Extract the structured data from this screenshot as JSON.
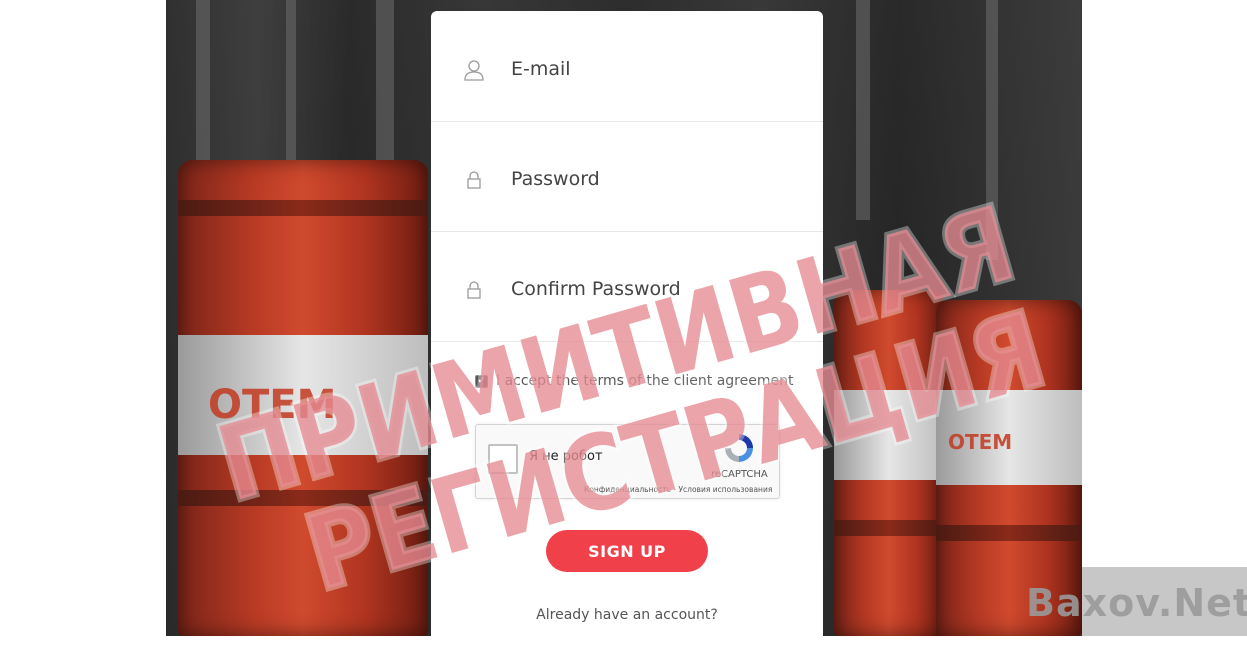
{
  "form": {
    "email_label": "E-mail",
    "password_label": "Password",
    "confirm_label": "Confirm Password",
    "terms_prefix": "I accept the terms",
    "terms_link": "of the client agreement",
    "terms_checked": true,
    "signup_label": "SIGN UP",
    "already_label": "Already have an account?"
  },
  "recaptcha": {
    "label": "Я не робот",
    "brand": "reCAPTCHA",
    "links": "Конфиденциальность - Условия использования"
  },
  "background": {
    "brand_text": "OTEM"
  },
  "overlay": {
    "line1": "ПРИМИТИВНАЯ",
    "line2": "РЕГИСТРАЦИЯ",
    "stamp_color": "#e05060"
  },
  "watermark": {
    "text": "Baxov.Net"
  },
  "colors": {
    "accent": "#f0414b"
  },
  "icons": [
    "user-icon",
    "lock-icon",
    "recaptcha-logo-icon"
  ]
}
